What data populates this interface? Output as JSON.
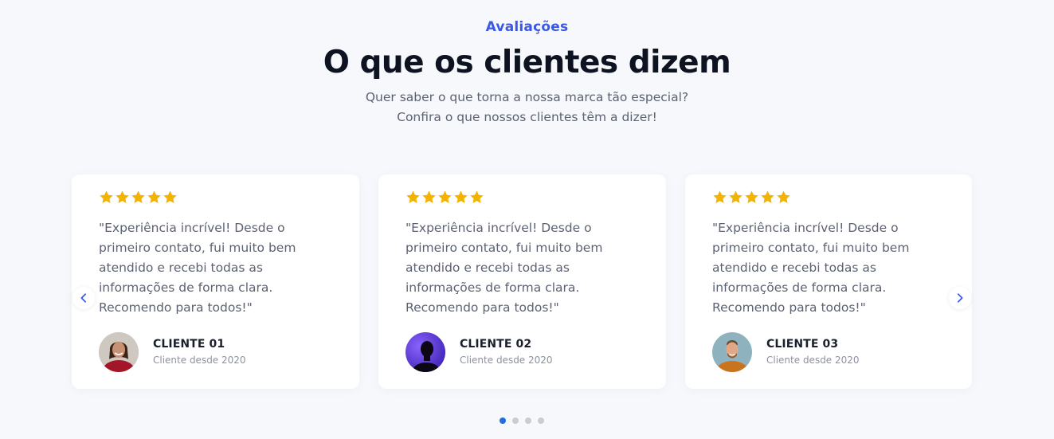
{
  "section": {
    "eyebrow": "Avaliações",
    "title": "O que os clientes dizem",
    "subtitle_line1": "Quer saber o que torna a nossa marca tão especial?",
    "subtitle_line2": "Confira o que nossos clientes têm a dizer!"
  },
  "testimonials": [
    {
      "rating": 5,
      "quote": "\"Experiência incrível! Desde o primeiro contato, fui muito bem atendido e recebi todas as informações de forma clara. Recomendo para todos!\"",
      "name": "CLIENTE 01",
      "since": "Cliente desde 2020"
    },
    {
      "rating": 5,
      "quote": "\"Experiência incrível! Desde o primeiro contato, fui muito bem atendido e recebi todas as informações de forma clara. Recomendo para todos!\"",
      "name": "CLIENTE 02",
      "since": "Cliente desde 2020"
    },
    {
      "rating": 5,
      "quote": "\"Experiência incrível! Desde o primeiro contato, fui muito bem atendido e recebi todas as informações de forma clara. Recomendo para todos!\"",
      "name": "CLIENTE 03",
      "since": "Cliente desde 2020"
    }
  ],
  "carousel": {
    "prev_icon": "chevron-left-icon",
    "next_icon": "chevron-right-icon",
    "page_count": 4,
    "active_page": 1
  },
  "colors": {
    "accent": "#3b57e6",
    "star": "#f5b301",
    "active_dot": "#1f6fe0",
    "inactive_dot": "#c9ccd3"
  }
}
